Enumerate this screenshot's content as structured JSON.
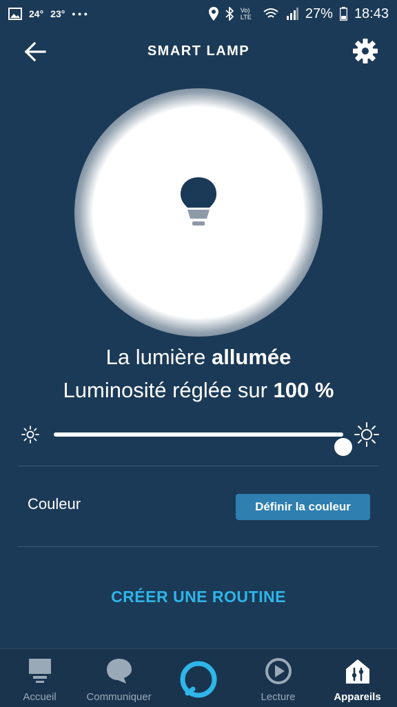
{
  "status_bar": {
    "temp1": "24°",
    "temp2": "23°",
    "more": "• • •",
    "network": "Vo) LTE",
    "battery": "27%",
    "time": "18:43"
  },
  "header": {
    "title": "SMART LAMP"
  },
  "device": {
    "state_prefix": "La lumière ",
    "state_value": "allumée",
    "brightness_prefix": "Luminosité réglée sur ",
    "brightness_value": "100 %",
    "brightness_level": 1.0
  },
  "color": {
    "label": "Couleur",
    "button": "Définir la couleur"
  },
  "routine": {
    "label": "CRÉER UNE ROUTINE"
  },
  "nav": {
    "items": [
      {
        "label": "Accueil",
        "icon": "home-icon"
      },
      {
        "label": "Communiquer",
        "icon": "chat-icon"
      },
      {
        "label": "",
        "icon": "alexa-icon"
      },
      {
        "label": "Lecture",
        "icon": "play-icon"
      },
      {
        "label": "Appareils",
        "icon": "devices-icon"
      }
    ]
  },
  "colors": {
    "background": "#1b3a57",
    "accent": "#2fb5e8",
    "button": "#2f7fb0"
  }
}
